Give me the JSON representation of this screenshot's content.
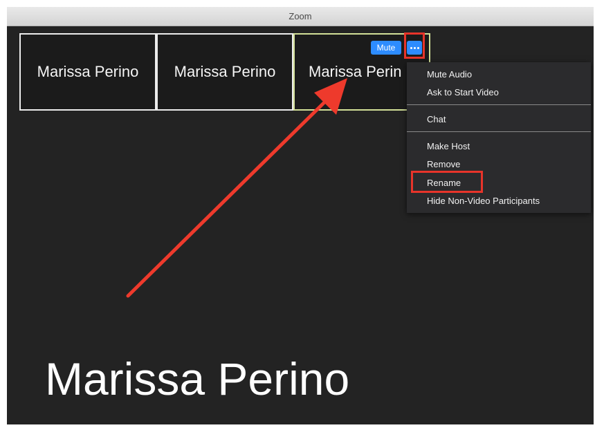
{
  "window": {
    "title": "Zoom"
  },
  "gallery": {
    "tiles": [
      {
        "name": "Marissa Perino"
      },
      {
        "name": "Marissa Perino"
      },
      {
        "name": "Marissa Perin"
      }
    ],
    "mute_label": "Mute",
    "more_icon": "ellipsis-icon"
  },
  "context_menu": {
    "items": [
      {
        "label": "Mute Audio"
      },
      {
        "label": "Ask to Start Video"
      },
      {
        "label": "Chat"
      },
      {
        "label": "Make Host"
      },
      {
        "label": "Remove"
      },
      {
        "label": "Rename"
      },
      {
        "label": "Hide Non-Video Participants"
      }
    ]
  },
  "active_speaker": {
    "name": "Marissa Perino"
  },
  "colors": {
    "accent": "#2d8cff",
    "highlight": "#e8342a",
    "background": "#232323",
    "active_tile_border": "#d3e098"
  }
}
